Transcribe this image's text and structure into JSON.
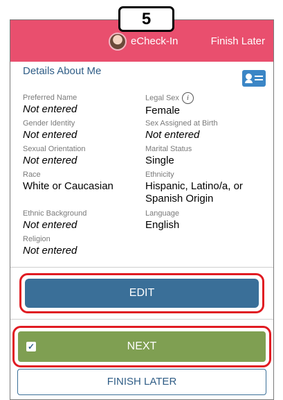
{
  "step_number": "5",
  "header": {
    "app_title": "eCheck-In",
    "finish_later": "Finish Later"
  },
  "section": {
    "title": "Details About Me",
    "icon": "id-card-icon"
  },
  "fields": {
    "preferred_name": {
      "label": "Preferred Name",
      "value": "Not entered"
    },
    "legal_sex": {
      "label": "Legal Sex",
      "value": "Female"
    },
    "gender_identity": {
      "label": "Gender Identity",
      "value": "Not entered"
    },
    "sex_assigned_at_birth": {
      "label": "Sex Assigned at Birth",
      "value": "Not entered"
    },
    "sexual_orientation": {
      "label": "Sexual Orientation",
      "value": "Not entered"
    },
    "marital_status": {
      "label": "Marital Status",
      "value": "Single"
    },
    "race": {
      "label": "Race",
      "value": "White or Caucasian"
    },
    "ethnicity": {
      "label": "Ethnicity",
      "value": "Hispanic, Latino/a, or Spanish Origin"
    },
    "ethnic_background": {
      "label": "Ethnic Background",
      "value": "Not entered"
    },
    "language": {
      "label": "Language",
      "value": "English"
    },
    "religion": {
      "label": "Religion",
      "value": "Not entered"
    }
  },
  "buttons": {
    "edit": "EDIT",
    "next": "NEXT",
    "finish_later": "FINISH LATER"
  },
  "colors": {
    "header": "#e94f6e",
    "edit_button": "#3a6f98",
    "next_button": "#7f9f52",
    "highlight": "#e01b22"
  }
}
